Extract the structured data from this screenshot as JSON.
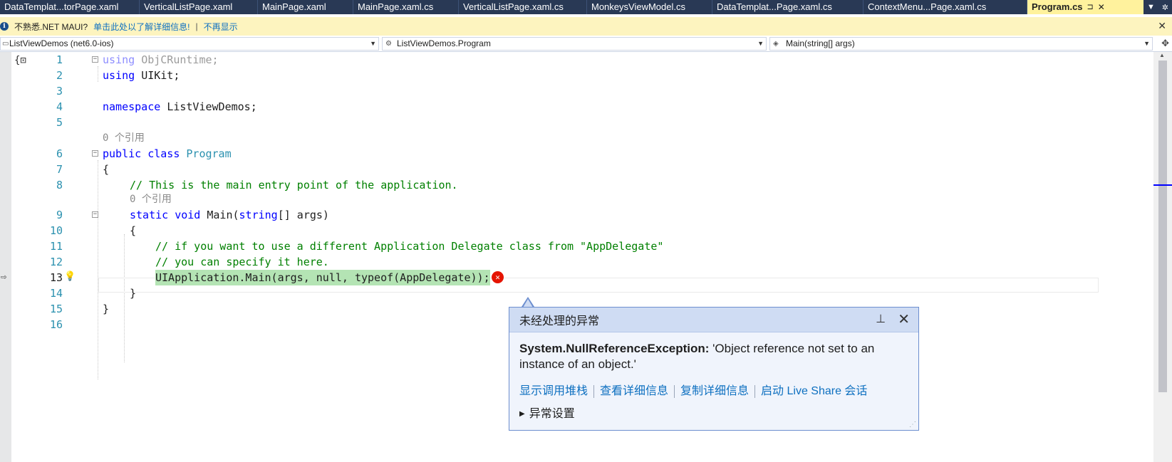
{
  "tabs": [
    {
      "label": "DataTemplat...torPage.xaml",
      "active": false
    },
    {
      "label": "VerticalListPage.xaml",
      "active": false
    },
    {
      "label": "MainPage.xaml",
      "active": false
    },
    {
      "label": "MainPage.xaml.cs",
      "active": false
    },
    {
      "label": "VerticalListPage.xaml.cs",
      "active": false
    },
    {
      "label": "MonkeysViewModel.cs",
      "active": false
    },
    {
      "label": "DataTemplat...Page.xaml.cs",
      "active": false
    },
    {
      "label": "ContextMenu...Page.xaml.cs",
      "active": false
    },
    {
      "label": "Program.cs",
      "active": true
    }
  ],
  "infobar": {
    "message": "不熟悉.NET MAUI?",
    "link": "单击此处以了解详细信息!",
    "separator": "|",
    "dismiss": "不再显示"
  },
  "nav": {
    "project": "ListViewDemos (net6.0-ios)",
    "type": "ListViewDemos.Program",
    "member": "Main(string[] args)"
  },
  "code": {
    "line_numbers": [
      "1",
      "2",
      "3",
      "4",
      "5",
      "6",
      "7",
      "8",
      "9",
      "10",
      "11",
      "12",
      "13",
      "14",
      "15",
      "16"
    ],
    "ref_hint": "0 个引用",
    "l1_kw": "using",
    "l1_ns": "ObjCRuntime;",
    "l2_kw": "using",
    "l2_ns": "UIKit;",
    "l4_kw": "namespace",
    "l4_ns": "ListViewDemos;",
    "l6_kw": "public class",
    "l6_type": "Program",
    "l7": "{",
    "l8": "// This is the main entry point of the application.",
    "l9_kw": "static void",
    "l9_name": "Main(",
    "l9_type": "string",
    "l9_rest": "[] args)",
    "l10": "{",
    "l11": "// if you want to use a different Application Delegate class from \"AppDelegate\"",
    "l12": "// you can specify it here.",
    "l13": "UIApplication.Main(args, null, typeof(AppDelegate));",
    "l14": "}",
    "l15": "}"
  },
  "exception": {
    "title": "未经处理的异常",
    "type": "System.NullReferenceException:",
    "message": "'Object reference not set to an instance of an object.'",
    "links": [
      "显示调用堆栈",
      "查看详细信息",
      "复制详细信息",
      "启动 Live Share 会话"
    ],
    "settings": "异常设置"
  },
  "colors": {
    "tab_strip": "#293955",
    "active_tab": "#fff29d",
    "infobar": "#fdf4bf",
    "keyword": "#0000ff",
    "type": "#2b91af",
    "comment": "#008000",
    "highlight": "#b4e4b4",
    "error": "#e51400",
    "popup_header": "#cfdcf3"
  },
  "icons": [
    "info-icon",
    "close-icon",
    "split-window-icon",
    "execution-arrow-icon",
    "lightbulb-icon",
    "error-icon",
    "pin-icon",
    "expand-triangle-icon"
  ]
}
